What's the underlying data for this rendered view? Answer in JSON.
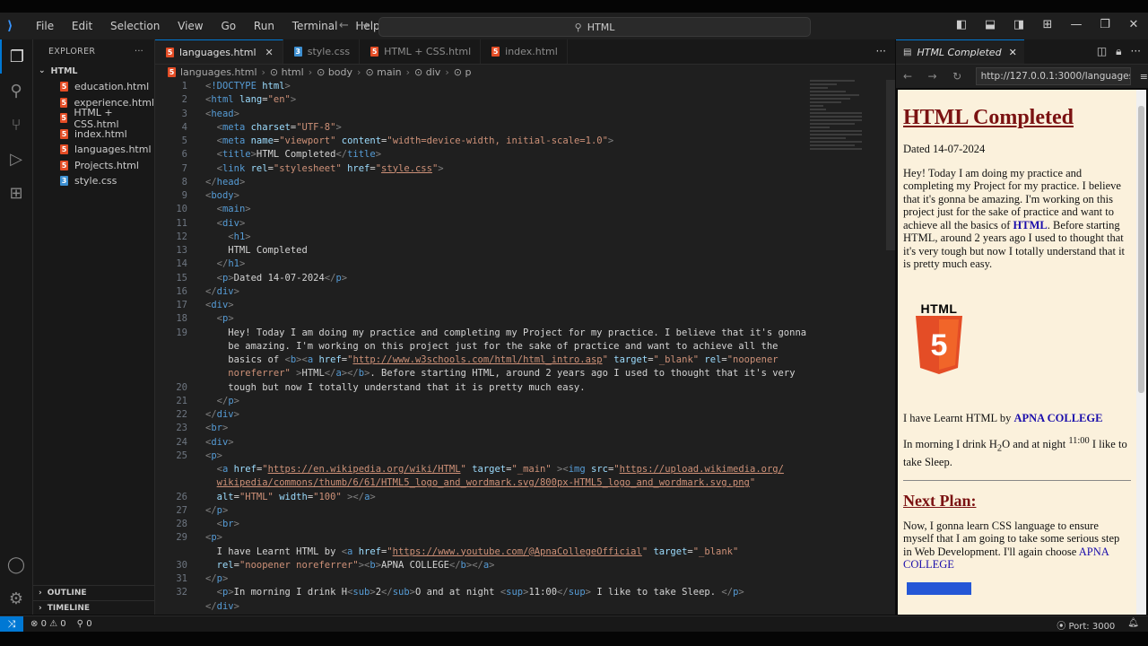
{
  "menu": [
    "File",
    "Edit",
    "Selection",
    "View",
    "Go",
    "Run",
    "Terminal",
    "Help"
  ],
  "command_center": "HTML",
  "explorer": {
    "title": "EXPLORER",
    "folder": "HTML",
    "files": [
      {
        "name": "education.html",
        "type": "html"
      },
      {
        "name": "experience.html",
        "type": "html"
      },
      {
        "name": "HTML + CSS.html",
        "type": "html"
      },
      {
        "name": "index.html",
        "type": "html"
      },
      {
        "name": "languages.html",
        "type": "html"
      },
      {
        "name": "Projects.html",
        "type": "html"
      },
      {
        "name": "style.css",
        "type": "css"
      }
    ],
    "outline": "OUTLINE",
    "timeline": "TIMELINE"
  },
  "tabs": [
    {
      "name": "languages.html",
      "type": "html",
      "active": true
    },
    {
      "name": "style.css",
      "type": "css",
      "active": false
    },
    {
      "name": "HTML + CSS.html",
      "type": "html",
      "active": false
    },
    {
      "name": "index.html",
      "type": "html",
      "active": false
    }
  ],
  "breadcrumb": [
    "languages.html",
    "html",
    "body",
    "main",
    "div",
    "p"
  ],
  "editor": {
    "line_numbers": [
      "1",
      "2",
      "3",
      "4",
      "5",
      "6",
      "7",
      "8",
      "9",
      "10",
      "11",
      "12",
      "13",
      "14",
      "15",
      "16",
      "17",
      "18",
      "19",
      "",
      "",
      "",
      "20",
      "21",
      "22",
      "23",
      "24",
      "25",
      "",
      "",
      "26",
      "27",
      "28",
      "29",
      "",
      "30",
      "31",
      "32"
    ]
  },
  "preview": {
    "tab_title": "HTML Completed",
    "url": "http://127.0.0.1:3000/languages.html",
    "h1": "HTML Completed",
    "dated": "Dated 14-07-2024",
    "para1_a": "Hey! Today I am doing my practice and completing my Project for my practice. I believe that it's gonna be amazing. I'm working on this project just for the sake of practice and want to achieve all the basics of ",
    "para1_link": "HTML",
    "para1_b": ". Before starting HTML, around 2 years ago I used to thought that it's very tough but now I totally understand that it is pretty much easy.",
    "logo_word": "HTML",
    "logo_number": "5",
    "learnt_a": "I have Learnt HTML by ",
    "learnt_link": "APNA COLLEGE",
    "water_a": "In morning I drink H",
    "water_sub": "2",
    "water_b": "O and at night ",
    "water_sup": "11:00",
    "water_c": " I like to take Sleep.",
    "h2": "Next Plan:",
    "plan_a": "Now, I gonna learn CSS language to ensure myself that I am going to take some serious step in Web Development. I'll again choose ",
    "plan_link": "APNA COLLEGE"
  },
  "status": {
    "errors": "0",
    "warnings": "0",
    "ports": "0",
    "port_label": "Port: 3000"
  }
}
